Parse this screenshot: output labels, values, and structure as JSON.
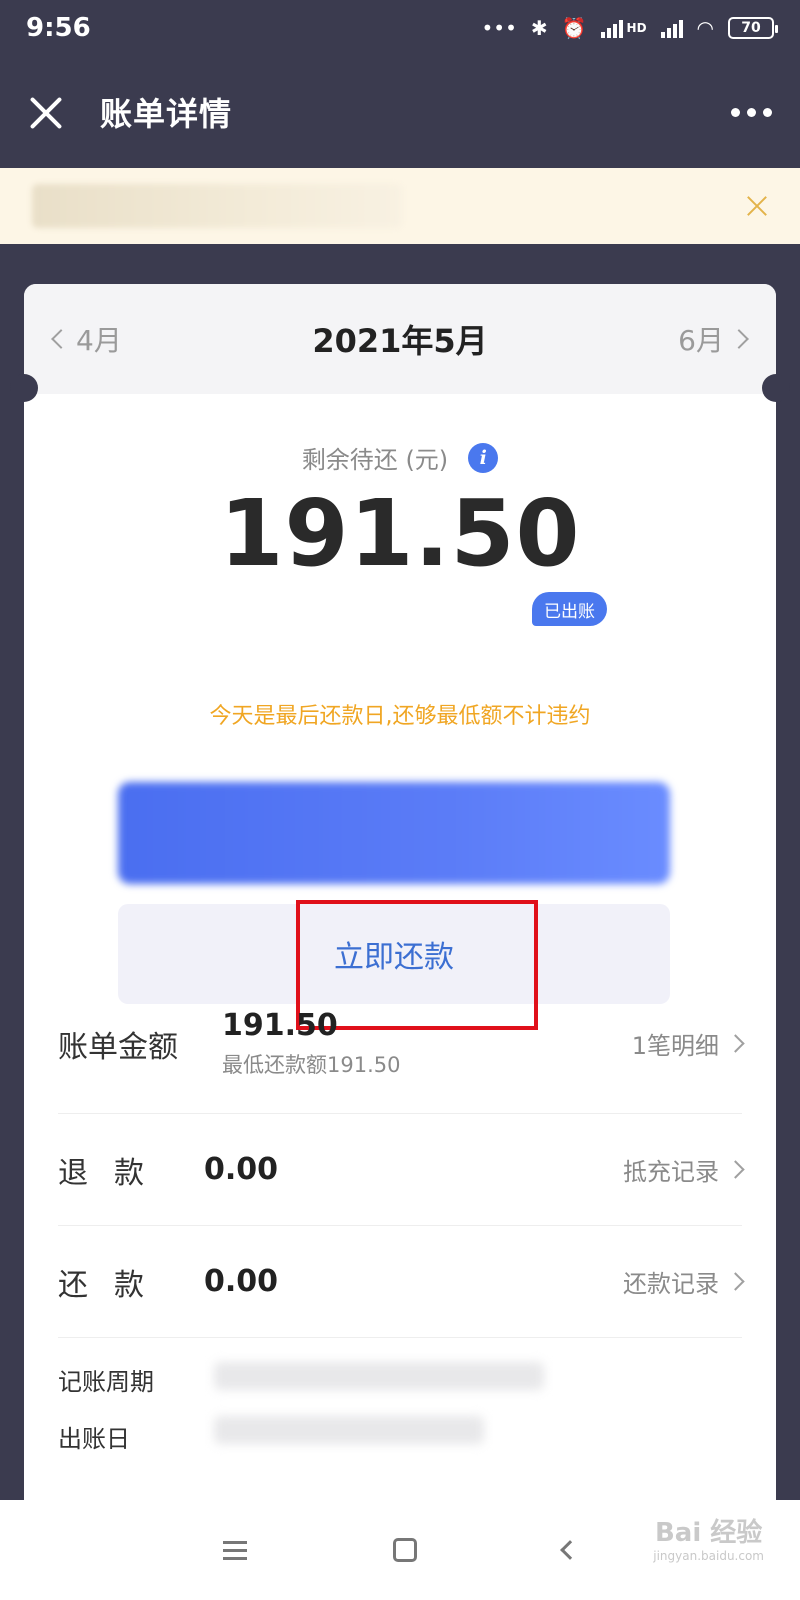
{
  "status_bar": {
    "time": "9:56",
    "dots": "•••",
    "hd_label": "HD",
    "battery": "70"
  },
  "header": {
    "title": "账单详情"
  },
  "bill": {
    "prev_month": "4月",
    "current_month": "2021年5月",
    "next_month": "6月",
    "remaining_label": "剩余待还 (元)",
    "info_icon_glyph": "i",
    "amount": "191.50",
    "status_badge": "已出账",
    "warning": "今天是最后还款日,还够最低额不计违约",
    "repay_button": "立即还款"
  },
  "details": {
    "bill_amount_label": "账单金额",
    "bill_amount_value": "191.50",
    "min_payment": "最低还款额191.50",
    "bill_link": "1笔明细",
    "refund_label": "退款",
    "refund_value": "0.00",
    "refund_link": "抵充记录",
    "repaid_label": "还款",
    "repaid_value": "0.00",
    "repaid_link": "还款记录",
    "cycle_label": "记账周期",
    "statement_day_label": "出账日"
  },
  "watermark": {
    "text": "Bai 经验",
    "sub": "jingyan.baidu.com"
  },
  "colors": {
    "accent": "#4a78ee",
    "warning": "#f0a623",
    "highlight": "#e0101a",
    "header_bg": "#3b3b4f"
  }
}
